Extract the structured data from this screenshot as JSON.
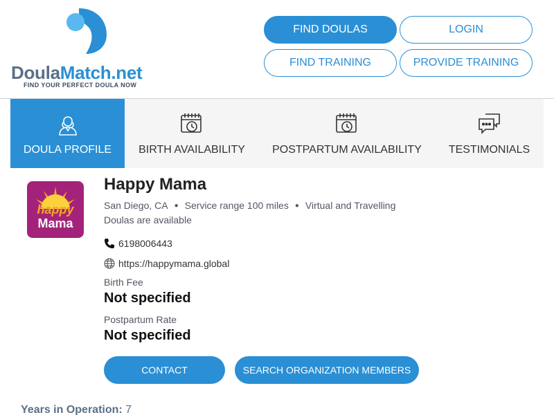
{
  "logo": {
    "name_part1": "Doula",
    "name_part2": "Match.net",
    "tagline": "FIND YOUR PERFECT DOULA NOW"
  },
  "nav": {
    "find_doulas": "FIND DOULAS",
    "login": "LOGIN",
    "find_training": "FIND TRAINING",
    "provide_training": "PROVIDE TRAINING"
  },
  "tabs": [
    {
      "label": "DOULA PROFILE",
      "icon": "doula-profile-icon",
      "active": true
    },
    {
      "label": "BIRTH AVAILABILITY",
      "icon": "calendar-clock-icon",
      "active": false
    },
    {
      "label": "POSTPARTUM AVAILABILITY",
      "icon": "calendar-clock-icon",
      "active": false
    },
    {
      "label": "TESTIMONIALS",
      "icon": "chat-bubbles-icon",
      "active": false
    }
  ],
  "profile": {
    "avatar_text_top": "happy",
    "avatar_text_bottom": "Mama",
    "name": "Happy Mama",
    "location": "San Diego, CA",
    "service_range": "Service range 100 miles",
    "service_mode": "Virtual and Travelling",
    "availability": "Doulas are available",
    "phone": "6198006443",
    "website": "https://happymama.global",
    "birth_fee_label": "Birth Fee",
    "birth_fee_value": "Not specified",
    "postpartum_label": "Postpartum Rate",
    "postpartum_value": "Not specified"
  },
  "actions": {
    "contact": "CONTACT",
    "search_members": "SEARCH ORGANIZATION MEMBERS"
  },
  "footer": {
    "years_label": "Years in Operation:",
    "years_value": "7"
  },
  "colors": {
    "accent": "#2a8fd4",
    "logo_gray": "#5a6f86",
    "avatar_bg": "#a4237a"
  }
}
